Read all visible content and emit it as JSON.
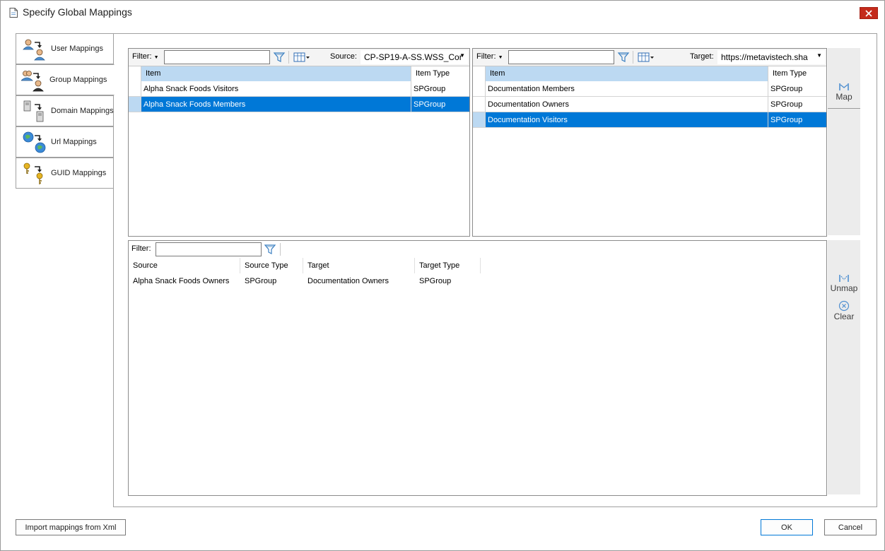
{
  "window": {
    "title": "Specify Global Mappings"
  },
  "tabs": [
    {
      "label": "User Mappings",
      "icon": "user-mapping-icon"
    },
    {
      "label": "Group Mappings",
      "icon": "group-mapping-icon"
    },
    {
      "label": "Domain Mappings",
      "icon": "domain-mapping-icon"
    },
    {
      "label": "Url Mappings",
      "icon": "url-mapping-icon"
    },
    {
      "label": "GUID Mappings",
      "icon": "guid-mapping-icon"
    }
  ],
  "active_tab": "Group Mappings",
  "source": {
    "filter_label": "Filter:",
    "filter_value": "",
    "combo_label": "Source:",
    "combo_value": "CP-SP19-A-SS.WSS_Cor",
    "columns": [
      "Item",
      "Item Type"
    ],
    "rows": [
      {
        "item": "Alpha Snack Foods Visitors",
        "type": "SPGroup"
      },
      {
        "item": "Alpha Snack Foods Members",
        "type": "SPGroup"
      }
    ],
    "selected_index": 1
  },
  "target": {
    "filter_label": "Filter:",
    "filter_value": "",
    "combo_label": "Target:",
    "combo_value": "https://metavistech.sha",
    "columns": [
      "Item",
      "Item Type"
    ],
    "rows": [
      {
        "item": "Documentation Members",
        "type": "SPGroup"
      },
      {
        "item": "Documentation Owners",
        "type": "SPGroup"
      },
      {
        "item": "Documentation Visitors",
        "type": "SPGroup"
      }
    ],
    "selected_index": 2
  },
  "actions": {
    "map": "Map",
    "unmap": "Unmap",
    "clear": "Clear"
  },
  "mappings": {
    "filter_label": "Filter:",
    "filter_value": "",
    "columns": [
      "Source",
      "Source Type",
      "Target",
      "Target Type"
    ],
    "rows": [
      {
        "source": "Alpha Snack Foods Owners",
        "source_type": "SPGroup",
        "target": "Documentation Owners",
        "target_type": "SPGroup"
      }
    ]
  },
  "footer": {
    "import": "Import mappings from Xml",
    "ok": "OK",
    "cancel": "Cancel"
  },
  "colors": {
    "selection": "#0078d7",
    "header_highlight": "#bcd9f2",
    "close": "#c42b1c"
  }
}
